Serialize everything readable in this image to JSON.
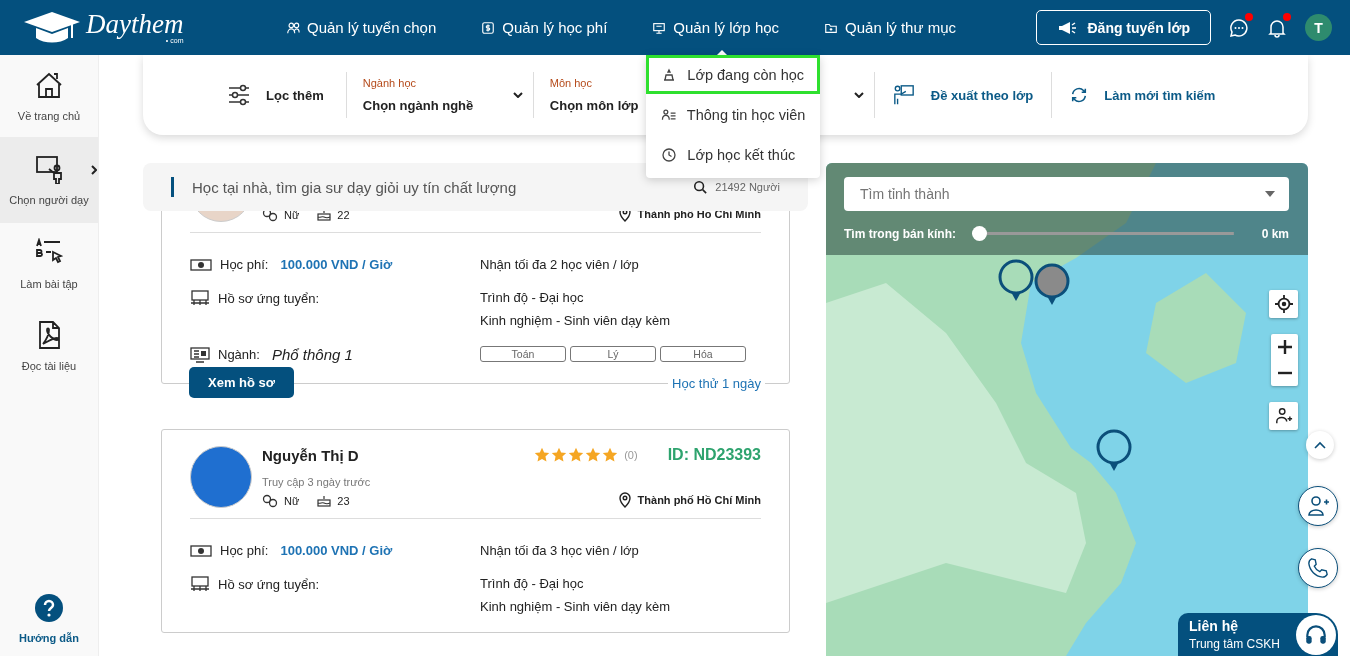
{
  "header": {
    "logo": {
      "name": "Daythem",
      "suffix": "• com"
    },
    "nav": [
      {
        "label": "Quản lý tuyển chọn"
      },
      {
        "label": "Quản lý học phí"
      },
      {
        "label": "Quản lý lớp học",
        "menu": [
          {
            "label": "Lớp đang còn học",
            "selected": true
          },
          {
            "label": "Thông tin học viên",
            "selected": false
          },
          {
            "label": "Lớp học kết thúc",
            "selected": false
          }
        ]
      },
      {
        "label": "Quản lý thư mục"
      }
    ],
    "post_button": "Đăng tuyển lớp",
    "messages": {
      "unread": true
    },
    "notifications": {
      "unread": true
    },
    "avatar": "T"
  },
  "sidebar": {
    "items": [
      {
        "label": "Về trang chủ",
        "selected": false
      },
      {
        "label": "Chọn người dạy",
        "selected": true
      },
      {
        "label": "Làm bài tập",
        "selected": false
      },
      {
        "label": "Đọc tài liệu",
        "selected": false
      }
    ],
    "help": "Hướng dẫn"
  },
  "filters": {
    "more": "Lọc thêm",
    "selects": [
      {
        "label": "Ngành học",
        "value": "Chọn ngành nghề"
      },
      {
        "label": "Môn học",
        "value": "Chọn môn lớp"
      }
    ],
    "suggest": "Đề xuất theo lớp",
    "reset": "Làm mới tìm kiếm"
  },
  "search": {
    "placeholder": "Học tại nhà, tìm gia sư dạy giỏi uy tín chất lượng",
    "count": "21492 Người"
  },
  "tutors": [
    {
      "gender": "Nữ",
      "age": "22",
      "location": "Thành phố Hồ Chí Minh",
      "fee_label": "Học phí:",
      "fee": "100.000 VND / Giờ",
      "capacity": "Nhận tối đa 2 học viên / lớp",
      "profile_label": "Hồ sơ ứng tuyển:",
      "education": "Trình độ - Đại học",
      "experience": "Kinh nghiệm - Sinh viên dạy kèm",
      "major_label": "Ngành:",
      "major": "Phổ thông 1",
      "subjects": [
        "Toán",
        "Lý",
        "Hóa"
      ],
      "action": "Xem hồ sơ",
      "trial": "Học thử 1 ngày"
    },
    {
      "name": "Nguyễn Thị D",
      "last_seen": "Truy cập 3 ngày trước",
      "stars": 5,
      "reviews": "(0)",
      "id": "ID: ND23393",
      "gender": "Nữ",
      "age": "23",
      "location": "Thành phố Hồ Chí Minh",
      "fee_label": "Học phí:",
      "fee": "100.000 VND / Giờ",
      "capacity": "Nhận tối đa 3 học viên / lớp",
      "profile_label": "Hồ sơ ứng tuyển:",
      "education": "Trình độ - Đại học",
      "experience": "Kinh nghiệm - Sinh viên dạy kèm"
    }
  ],
  "map": {
    "province": {
      "placeholder": "Tìm tỉnh thành"
    },
    "radius": {
      "label": "Tìm trong bán kính:",
      "level": 0,
      "reading": "0 km"
    }
  },
  "contact": {
    "title": "Liên hệ",
    "subtitle": "Trung tâm CSKH"
  }
}
